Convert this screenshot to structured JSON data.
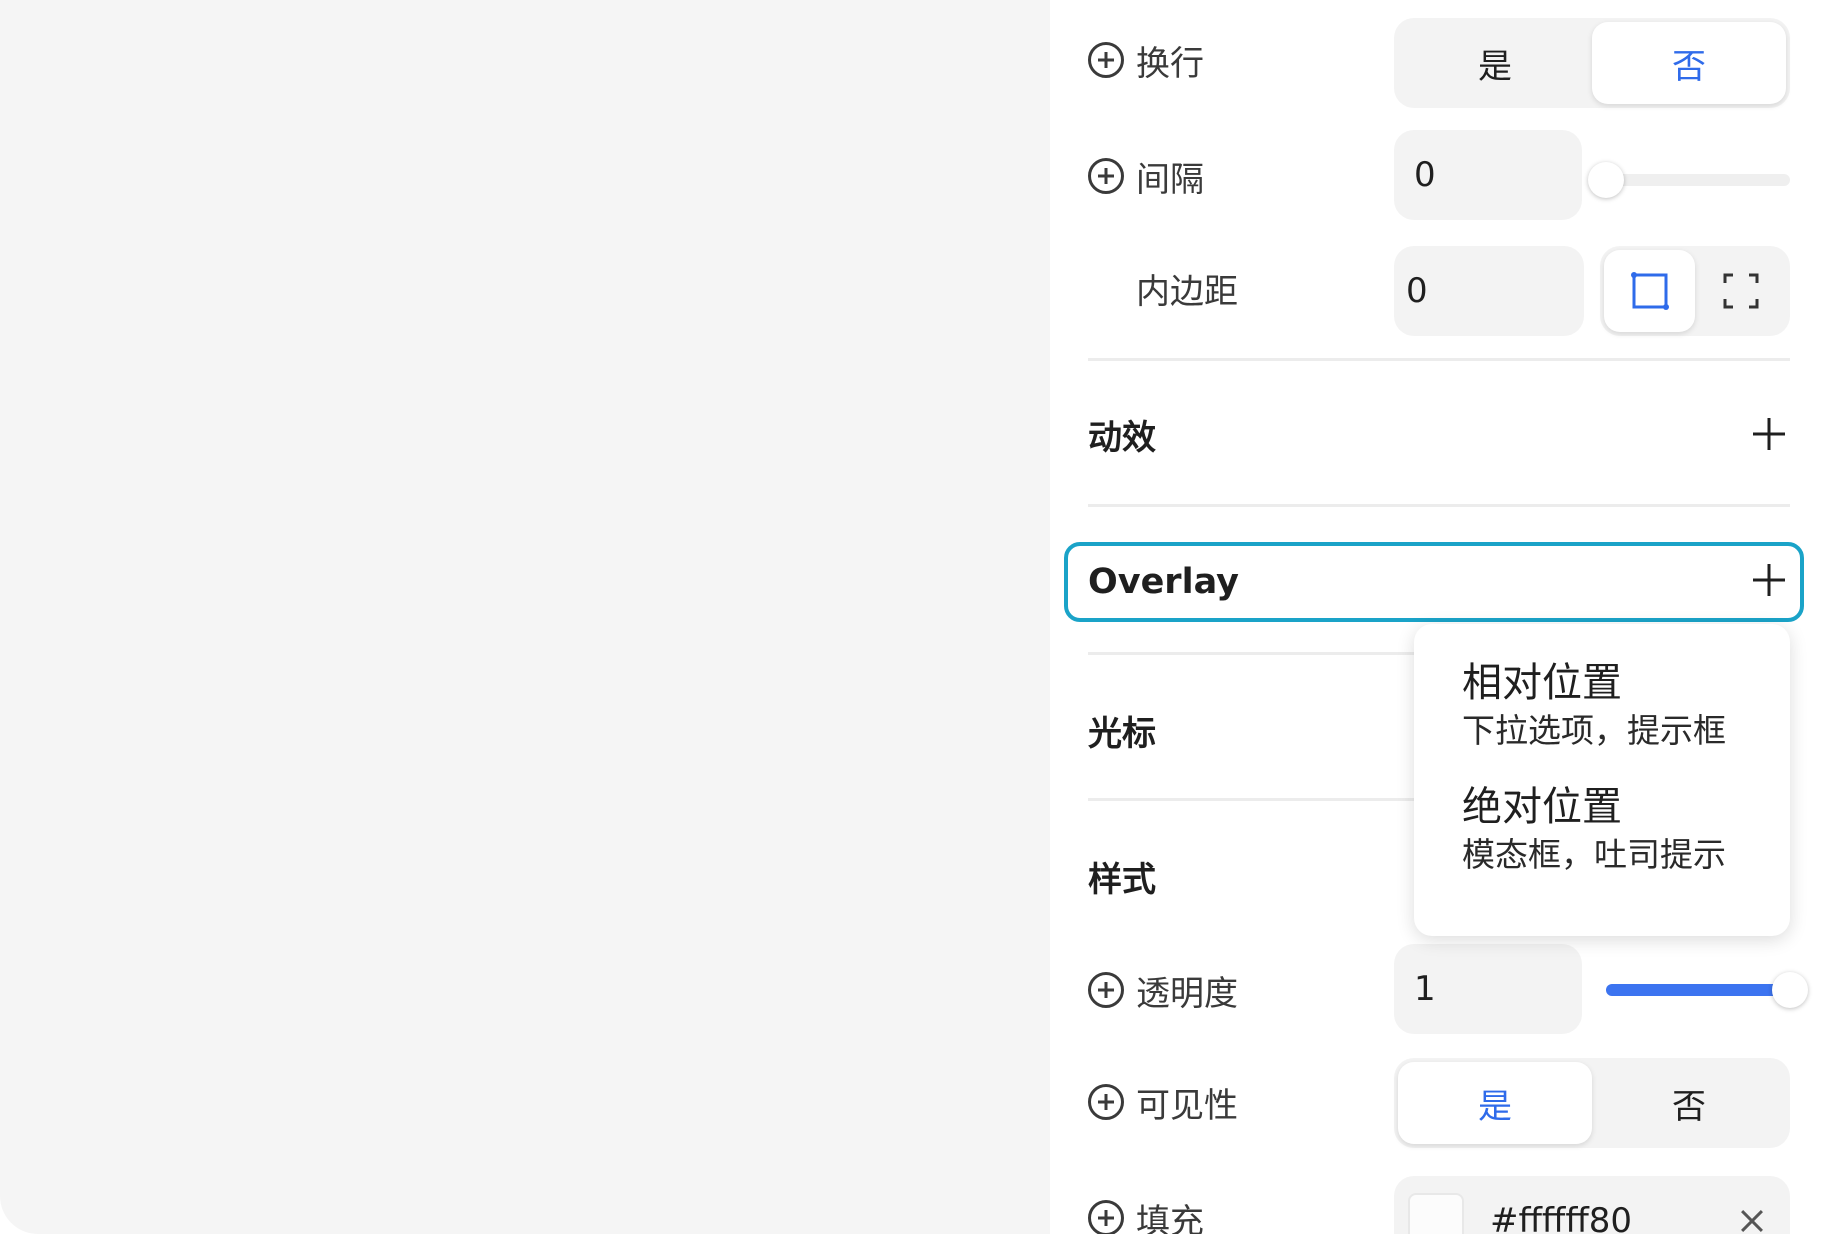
{
  "colors": {
    "accent": "#2f6bea",
    "slider_fill": "#3c74f0",
    "focus_ring": "#1aa3c8",
    "canvas_bg": "#f5f5f5"
  },
  "props": {
    "wrap": {
      "label": "换行",
      "options": [
        "是",
        "否"
      ],
      "selected": "否"
    },
    "gap": {
      "label": "间隔",
      "value": "0",
      "slider_fraction": 0.0
    },
    "padding": {
      "label": "内边距",
      "value": "0",
      "mode_icons": [
        "padding-uniform-icon",
        "padding-individual-icon"
      ],
      "selected_mode": "padding-uniform-icon"
    }
  },
  "sections": {
    "animation": {
      "title": "动效"
    },
    "overlay": {
      "title": "Overlay"
    },
    "cursor": {
      "title": "光标"
    },
    "style": {
      "title": "样式"
    }
  },
  "overlay_menu": {
    "items": [
      {
        "title": "相对位置",
        "subtitle": "下拉选项，提示框"
      },
      {
        "title": "绝对位置",
        "subtitle": "模态框，吐司提示"
      }
    ]
  },
  "style_props": {
    "opacity": {
      "label": "透明度",
      "value": "1",
      "slider_fraction": 1.0
    },
    "visibility": {
      "label": "可见性",
      "options": [
        "是",
        "否"
      ],
      "selected": "是"
    },
    "fill": {
      "label": "填充",
      "value": "#ffffff80"
    }
  }
}
